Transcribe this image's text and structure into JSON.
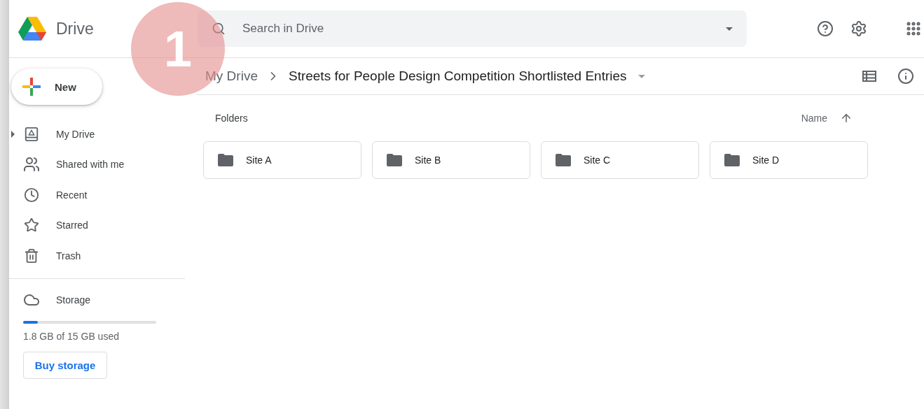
{
  "header": {
    "app_name": "Drive",
    "search": {
      "placeholder": "Search in Drive"
    }
  },
  "step_badge": {
    "label": "1"
  },
  "new_button": {
    "label": "New"
  },
  "sidebar": {
    "items": [
      {
        "label": "My Drive",
        "expandable": true
      },
      {
        "label": "Shared with me",
        "expandable": false
      },
      {
        "label": "Recent",
        "expandable": false
      },
      {
        "label": "Starred",
        "expandable": false
      },
      {
        "label": "Trash",
        "expandable": false
      }
    ],
    "storage": {
      "label": "Storage",
      "level": 0.11,
      "usage": "1.8 GB of 15 GB used",
      "button": "Buy storage"
    }
  },
  "breadcrumb": [
    "My Drive",
    "Streets for People Design Competition Shortlisted Entries"
  ],
  "folders": {
    "heading": "Folders",
    "sort": "Name",
    "items": [
      {
        "name": "Site A"
      },
      {
        "name": "Site B"
      },
      {
        "name": "Site C"
      },
      {
        "name": "Site D"
      }
    ]
  }
}
